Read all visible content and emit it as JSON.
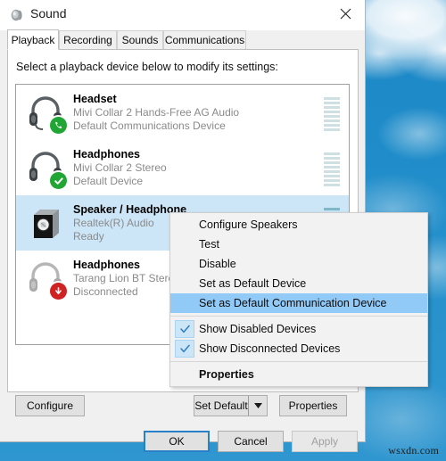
{
  "desktop": {
    "watermark": "wsxdn.com"
  },
  "window": {
    "title": "Sound",
    "icon": "speaker-icon",
    "close_label": "Close"
  },
  "tabs": [
    {
      "label": "Playback",
      "active": true
    },
    {
      "label": "Recording",
      "active": false
    },
    {
      "label": "Sounds",
      "active": false
    },
    {
      "label": "Communications",
      "active": false
    }
  ],
  "playback": {
    "hint": "Select a playback device below to modify its settings:",
    "devices": [
      {
        "name": "Headset",
        "driver": "Mivi Collar 2 Hands-Free AG Audio",
        "status": "Default Communications Device",
        "icon": "headset-icon",
        "badge": "phone-green-badge",
        "selected": false,
        "meter_level": 0
      },
      {
        "name": "Headphones",
        "driver": "Mivi Collar 2 Stereo",
        "status": "Default Device",
        "icon": "headphones-icon",
        "badge": "check-green-badge",
        "selected": false,
        "meter_level": 0
      },
      {
        "name": "Speaker / Headphone",
        "driver": "Realtek(R) Audio",
        "status": "Ready",
        "icon": "speaker-box-icon",
        "badge": "none",
        "selected": true,
        "meter_level": 0
      },
      {
        "name": "Headphones",
        "driver": "Tarang Lion BT Stereo",
        "status": "Disconnected",
        "icon": "headphones-disabled-icon",
        "badge": "arrow-down-red-badge",
        "selected": false,
        "meter_level": 0
      }
    ]
  },
  "buttons": {
    "configure": "Configure",
    "set_default": "Set Default",
    "set_default_arrow": "chevron-down-icon",
    "properties": "Properties",
    "ok": "OK",
    "cancel": "Cancel",
    "apply": "Apply"
  },
  "context_menu": {
    "items": [
      {
        "label": "Configure Speakers",
        "type": "item",
        "checked": false,
        "highlight": false,
        "bold": false
      },
      {
        "label": "Test",
        "type": "item",
        "checked": false,
        "highlight": false,
        "bold": false
      },
      {
        "label": "Disable",
        "type": "item",
        "checked": false,
        "highlight": false,
        "bold": false
      },
      {
        "label": "Set as Default Device",
        "type": "item",
        "checked": false,
        "highlight": false,
        "bold": false
      },
      {
        "label": "Set as Default Communication Device",
        "type": "item",
        "checked": false,
        "highlight": true,
        "bold": false
      },
      {
        "type": "separator"
      },
      {
        "label": "Show Disabled Devices",
        "type": "item",
        "checked": true,
        "highlight": false,
        "bold": false
      },
      {
        "label": "Show Disconnected Devices",
        "type": "item",
        "checked": true,
        "highlight": false,
        "bold": false
      },
      {
        "type": "separator"
      },
      {
        "label": "Properties",
        "type": "item",
        "checked": false,
        "highlight": false,
        "bold": true
      }
    ]
  },
  "colors": {
    "accent_selection": "#cde6f7",
    "menu_highlight": "#91c9f7",
    "default_button_border": "#2a7fc9",
    "badge_green": "#21a636",
    "badge_red": "#cf2323"
  }
}
